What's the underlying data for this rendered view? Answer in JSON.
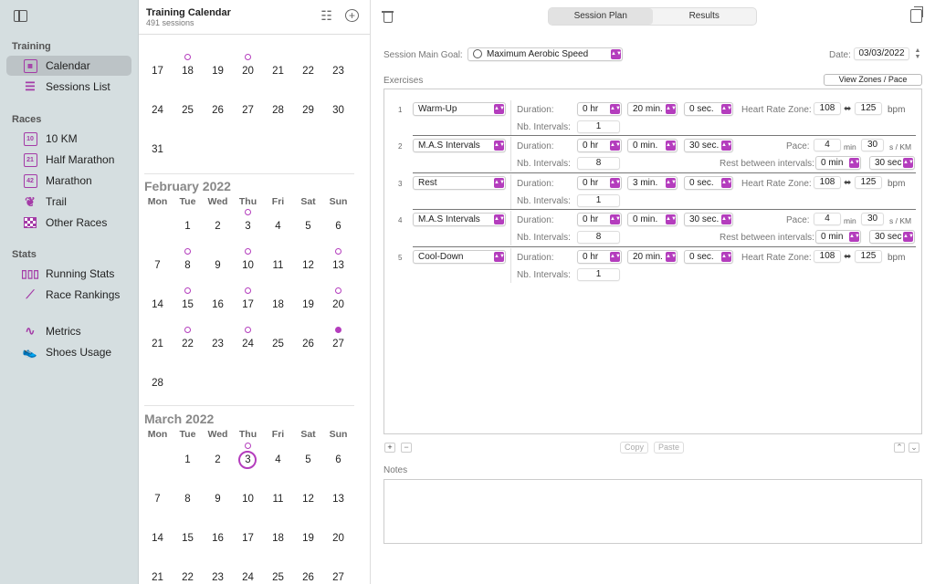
{
  "sidebar": {
    "training_head": "Training",
    "calendar": "Calendar",
    "sessions_list": "Sessions List",
    "races_head": "Races",
    "km10": "10 KM",
    "half": "Half Marathon",
    "marathon": "Marathon",
    "trail": "Trail",
    "other": "Other Races",
    "stats_head": "Stats",
    "running_stats": "Running Stats",
    "race_rankings": "Race Rankings",
    "metrics": "Metrics",
    "shoes": "Shoes Usage",
    "icon_10": "10",
    "icon_21": "21",
    "icon_42": "42"
  },
  "calendar": {
    "title": "Training Calendar",
    "subtitle": "491 sessions",
    "weekdays": [
      "Mon",
      "Tue",
      "Wed",
      "Thu",
      "Fri",
      "Sat",
      "Sun"
    ],
    "jan_rows": [
      [
        "17",
        "18",
        "19",
        "20",
        "21",
        "22",
        "23"
      ],
      [
        "24",
        "25",
        "26",
        "27",
        "28",
        "29",
        "30"
      ],
      [
        "31"
      ]
    ],
    "feb_title": "February 2022",
    "feb_rows": [
      [
        "",
        "1",
        "2",
        "3",
        "4",
        "5",
        "6"
      ],
      [
        "7",
        "8",
        "9",
        "10",
        "11",
        "12",
        "13"
      ],
      [
        "14",
        "15",
        "16",
        "17",
        "18",
        "19",
        "20"
      ],
      [
        "21",
        "22",
        "23",
        "24",
        "25",
        "26",
        "27"
      ],
      [
        "28"
      ]
    ],
    "mar_title": "March 2022",
    "mar_rows": [
      [
        "",
        "1",
        "2",
        "3",
        "4",
        "5",
        "6"
      ],
      [
        "7",
        "8",
        "9",
        "10",
        "11",
        "12",
        "13"
      ],
      [
        "14",
        "15",
        "16",
        "17",
        "18",
        "19",
        "20"
      ],
      [
        "21",
        "22",
        "23",
        "24",
        "25",
        "26",
        "27"
      ]
    ]
  },
  "main": {
    "tab_plan": "Session Plan",
    "tab_results": "Results",
    "goal_label": "Session Main Goal:",
    "goal_value": "Maximum Aerobic Speed",
    "date_label": "Date:",
    "date_value": "03/03/2022",
    "exercises_label": "Exercises",
    "view_zones": "View Zones / Pace",
    "duration_label": "Duration:",
    "nb_intervals_label": "Nb. Intervals:",
    "hr_zone_label": "Heart Rate Zone:",
    "pace_label": "Pace:",
    "rest_label": "Rest between intervals:",
    "bpm": "bpm",
    "min_unit": "min",
    "s_km": "s / KM",
    "copy": "Copy",
    "paste": "Paste",
    "notes_label": "Notes",
    "plus": "+",
    "minus": "−",
    "rows": [
      {
        "n": "1",
        "type": "Warm-Up",
        "hr": "0 hr",
        "min": "20 min.",
        "sec": "0 sec.",
        "intervals": "1",
        "hr_lo": "108",
        "hr_hi": "125"
      },
      {
        "n": "2",
        "type": "M.A.S Intervals",
        "hr": "0 hr",
        "min": "0 min.",
        "sec": "30 sec.",
        "intervals": "8",
        "pace_min": "4",
        "pace_s": "30",
        "rest_min": "0 min",
        "rest_sec": "30 sec"
      },
      {
        "n": "3",
        "type": "Rest",
        "hr": "0 hr",
        "min": "3 min.",
        "sec": "0 sec.",
        "intervals": "1",
        "hr_lo": "108",
        "hr_hi": "125"
      },
      {
        "n": "4",
        "type": "M.A.S Intervals",
        "hr": "0 hr",
        "min": "0 min.",
        "sec": "30 sec.",
        "intervals": "8",
        "pace_min": "4",
        "pace_s": "30",
        "rest_min": "0 min",
        "rest_sec": "30 sec"
      },
      {
        "n": "5",
        "type": "Cool-Down",
        "hr": "0 hr",
        "min": "20 min.",
        "sec": "0 sec.",
        "intervals": "1",
        "hr_lo": "108",
        "hr_hi": "125"
      }
    ]
  },
  "colors": {
    "accent": "#b43dbd",
    "sidebar": "#d5dee0"
  }
}
